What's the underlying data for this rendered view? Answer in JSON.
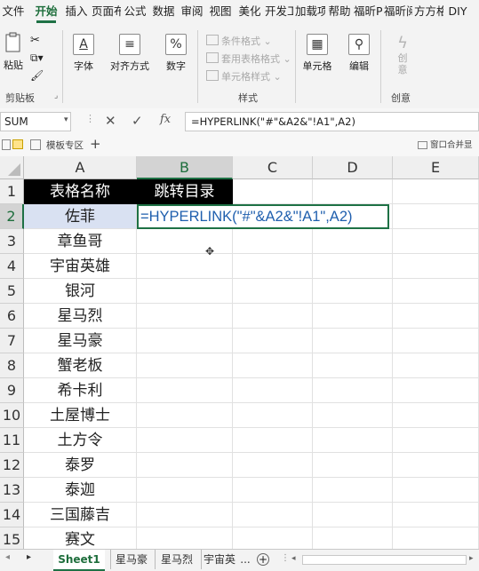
{
  "ribbon_tabs": [
    "文件",
    "开始",
    "插入",
    "页面布",
    "公式",
    "数据",
    "审阅",
    "视图",
    "美化",
    "开发工",
    "加载项",
    "帮助",
    "福昕P",
    "福昕阅",
    "方方格",
    "DIY"
  ],
  "active_tab_index": 1,
  "clipboard": {
    "paste_label": "粘贴",
    "group_label": "剪贴板"
  },
  "font": {
    "label": "字体",
    "icon_glyph": "A"
  },
  "alignment": {
    "label": "对齐方式"
  },
  "number": {
    "label": "数字",
    "icon_glyph": "%"
  },
  "styles": {
    "conditional": "条件格式",
    "table": "套用表格格式",
    "cell": "单元格样式",
    "group_label": "样式"
  },
  "cells": {
    "label": "单元格"
  },
  "editing": {
    "label": "编辑"
  },
  "create": {
    "label": "创意",
    "group_label": "创意"
  },
  "formula_bar": {
    "name_box": "SUM",
    "fx": "fx",
    "formula": "=HYPERLINK(\"#\"&A2&\"!A1\",A2)"
  },
  "workbook_strip": {
    "template_area": "模板专区",
    "add": "+",
    "window_merge": "窗口合并显示"
  },
  "columns": [
    "A",
    "B",
    "C",
    "D",
    "E"
  ],
  "rows": [
    "1",
    "2",
    "3",
    "4",
    "5",
    "6",
    "7",
    "8",
    "9",
    "10",
    "11",
    "12",
    "13",
    "14",
    "15"
  ],
  "selected_row_index": 1,
  "selected_col_index": 1,
  "header_row": {
    "a1": "表格名称",
    "b1": "跳转目录"
  },
  "column_a_values": [
    "佐菲",
    "章鱼哥",
    "宇宙英雄",
    "银河",
    "星马烈",
    "星马豪",
    "蟹老板",
    "希卡利",
    "土屋博士",
    "土方令",
    "泰罗",
    "泰迦",
    "三国藤吉",
    "赛文"
  ],
  "editing_cell_text": "=HYPERLINK(\"#\"&A2&\"!A1\",A2)",
  "sheet_tabs": [
    "Sheet1",
    "星马豪",
    "星马烈",
    "宇宙英"
  ],
  "sheet_more": "...",
  "accent_color": "#1e7145"
}
